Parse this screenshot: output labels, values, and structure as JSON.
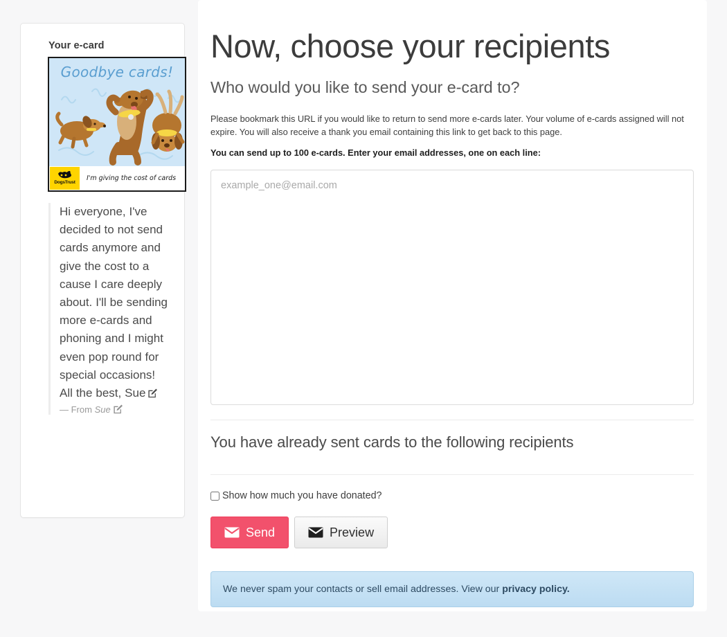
{
  "card_preview": {
    "label": "Your e-card",
    "ecard_title": "Goodbye cards!",
    "logo_name": "DogsTrust",
    "tagline": "I'm giving the cost of cards",
    "message": "Hi everyone, I've decided to not send cards anymore and give the cost to a cause I care deeply about. I'll be sending more e-cards and phoning and I might even pop round for special occasions! All the best, Sue",
    "from_prefix": "— From",
    "from_name": "Sue",
    "edit_icon": "edit-pencil-icon"
  },
  "main": {
    "title": "Now, choose your recipients",
    "subtitle": "Who would you like to send your e-card to?",
    "intro": "Please bookmark this URL if you would like to return to send more e-cards later. Your volume of e-cards assigned will not expire. You will also receive a thank you email containing this link to get back to this page.",
    "limit_text": "You can send up to 100 e-cards. Enter your email addresses, one on each line:",
    "recipients_placeholder": "example_one@email.com",
    "recipients_value": "",
    "already_sent_heading": "You have already sent cards to the following recipients",
    "donation_checkbox_label": "Show how much you have donated?",
    "donation_checkbox_checked": false,
    "send_label": "Send",
    "preview_label": "Preview",
    "privacy_text": "We never spam your contacts or sell email addresses. View our ",
    "privacy_link": "privacy policy."
  },
  "colors": {
    "page_background": "#f7f7f8",
    "send_button": "#f2516c",
    "preview_button": "#eaeaea",
    "notice_background": "#c6e2f5",
    "ecard_background": "#cfe6f7",
    "logo_yellow": "#ffd400",
    "ecard_title_blue": "#5a9ed0"
  }
}
